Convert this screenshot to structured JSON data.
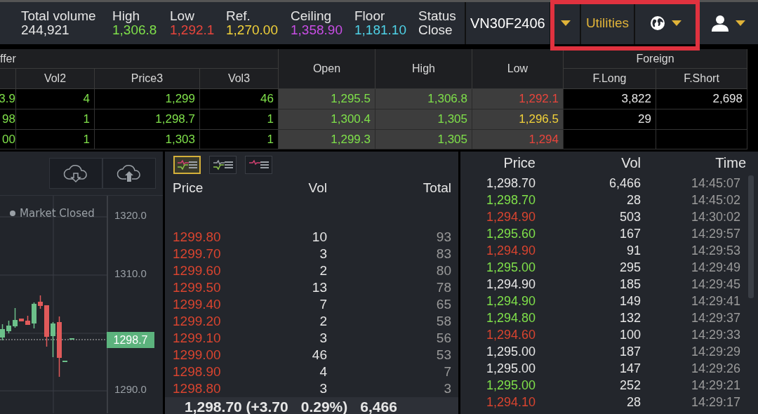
{
  "stats": [
    {
      "label": "Total volume",
      "value": "244,921",
      "color": "#e6e6e6"
    },
    {
      "label": "High",
      "value": "1,306.8",
      "color": "#7fe04a"
    },
    {
      "label": "Low",
      "value": "1,292.1",
      "color": "#e8453c"
    },
    {
      "label": "Ref.",
      "value": "1,270.00",
      "color": "#f2d23a"
    },
    {
      "label": "Ceiling",
      "value": "1,358.90",
      "color": "#c94ee6"
    },
    {
      "label": "Floor",
      "value": "1,181.10",
      "color": "#4fd3e8"
    },
    {
      "label": "Status",
      "value": "Close",
      "color": "#e6e6e6"
    }
  ],
  "symbol": "VN30F2406",
  "utilities": "Utilities",
  "table": {
    "group_headers": [
      "ffer",
      "Open",
      "High",
      "Low",
      "Foreign"
    ],
    "columns": [
      "Vol2",
      "Price3",
      "Vol3",
      "F.Long",
      "F.Short"
    ],
    "rows": [
      {
        "cells": [
          {
            "text": "3.9",
            "color": "#7fe04a"
          },
          {
            "text": "4",
            "color": "#7fe04a"
          },
          {
            "text": "1,299",
            "color": "#7fe04a"
          },
          {
            "text": "46",
            "color": "#7fe04a"
          },
          {
            "text": "1,295.5",
            "color": "#7fe04a"
          },
          {
            "text": "1,306.8",
            "color": "#7fe04a"
          },
          {
            "text": "1,292.1",
            "color": "#e8453c"
          },
          {
            "text": "3,822",
            "color": "#e6e6e6"
          },
          {
            "text": "2,698",
            "color": "#e6e6e6"
          }
        ]
      },
      {
        "cells": [
          {
            "text": "98",
            "color": "#7fe04a"
          },
          {
            "text": "1",
            "color": "#7fe04a"
          },
          {
            "text": "1,298.7",
            "color": "#7fe04a"
          },
          {
            "text": "1",
            "color": "#7fe04a"
          },
          {
            "text": "1,300.4",
            "color": "#7fe04a"
          },
          {
            "text": "1,305",
            "color": "#7fe04a"
          },
          {
            "text": "1,296.5",
            "color": "#f2d23a"
          },
          {
            "text": "29",
            "color": "#e6e6e6"
          }
        ]
      },
      {
        "cells": [
          {
            "text": "00",
            "color": "#7fe04a"
          },
          {
            "text": "1",
            "color": "#7fe04a"
          },
          {
            "text": "1,303",
            "color": "#7fe04a"
          },
          {
            "text": "1",
            "color": "#7fe04a"
          },
          {
            "text": "1,299.3",
            "color": "#7fe04a"
          },
          {
            "text": "1,305",
            "color": "#7fe04a"
          },
          {
            "text": "1,294",
            "color": "#e8453c"
          }
        ]
      }
    ]
  },
  "chart": {
    "status": "Market Closed",
    "axis_labels": [
      "1320.0",
      "1310.0",
      "1290.0"
    ],
    "last_price": "1298.7"
  },
  "order_book": {
    "views": [
      {
        "selected": true
      },
      {
        "selected": false
      },
      {
        "selected": false
      }
    ],
    "columns": [
      "Price",
      "Vol",
      "Total"
    ],
    "rows": [
      {
        "price": "1299.80",
        "vol": "10",
        "total": "93"
      },
      {
        "price": "1299.70",
        "vol": "3",
        "total": "83"
      },
      {
        "price": "1299.60",
        "vol": "2",
        "total": "80"
      },
      {
        "price": "1299.50",
        "vol": "13",
        "total": "78"
      },
      {
        "price": "1299.40",
        "vol": "7",
        "total": "65"
      },
      {
        "price": "1299.20",
        "vol": "2",
        "total": "58"
      },
      {
        "price": "1299.10",
        "vol": "3",
        "total": "56"
      },
      {
        "price": "1299.00",
        "vol": "46",
        "total": "53"
      },
      {
        "price": "1298.90",
        "vol": "4",
        "total": "7"
      },
      {
        "price": "1298.80",
        "vol": "3",
        "total": "3"
      }
    ],
    "summary": [
      "1,298.70 (+3.70",
      "0.29%)",
      "6,466"
    ]
  },
  "trades": {
    "columns": [
      "Price",
      "Vol",
      "Time"
    ],
    "rows": [
      {
        "price": "1,298.70",
        "color": "#e6e6e6",
        "vol": "6,466",
        "time": "14:45:07"
      },
      {
        "price": "1,298.70",
        "color": "#7fe04a",
        "vol": "28",
        "time": "14:45:02"
      },
      {
        "price": "1,294.90",
        "color": "#d9442f",
        "vol": "503",
        "time": "14:30:02"
      },
      {
        "price": "1,295.60",
        "color": "#7fe04a",
        "vol": "167",
        "time": "14:29:57"
      },
      {
        "price": "1,294.90",
        "color": "#d9442f",
        "vol": "91",
        "time": "14:29:53"
      },
      {
        "price": "1,295.00",
        "color": "#7fe04a",
        "vol": "295",
        "time": "14:29:49"
      },
      {
        "price": "1,294.90",
        "color": "#e6e6e6",
        "vol": "185",
        "time": "14:29:45"
      },
      {
        "price": "1,294.90",
        "color": "#7fe04a",
        "vol": "149",
        "time": "14:29:41"
      },
      {
        "price": "1,294.80",
        "color": "#7fe04a",
        "vol": "132",
        "time": "14:29:37"
      },
      {
        "price": "1,294.60",
        "color": "#d9442f",
        "vol": "100",
        "time": "14:29:33"
      },
      {
        "price": "1,295.00",
        "color": "#e6e6e6",
        "vol": "187",
        "time": "14:29:29"
      },
      {
        "price": "1,295.00",
        "color": "#e6e6e6",
        "vol": "147",
        "time": "14:29:26"
      },
      {
        "price": "1,295.00",
        "color": "#7fe04a",
        "vol": "252",
        "time": "14:29:21"
      },
      {
        "price": "1,294.10",
        "color": "#d9442f",
        "vol": "28",
        "time": "14:29:17"
      }
    ]
  }
}
